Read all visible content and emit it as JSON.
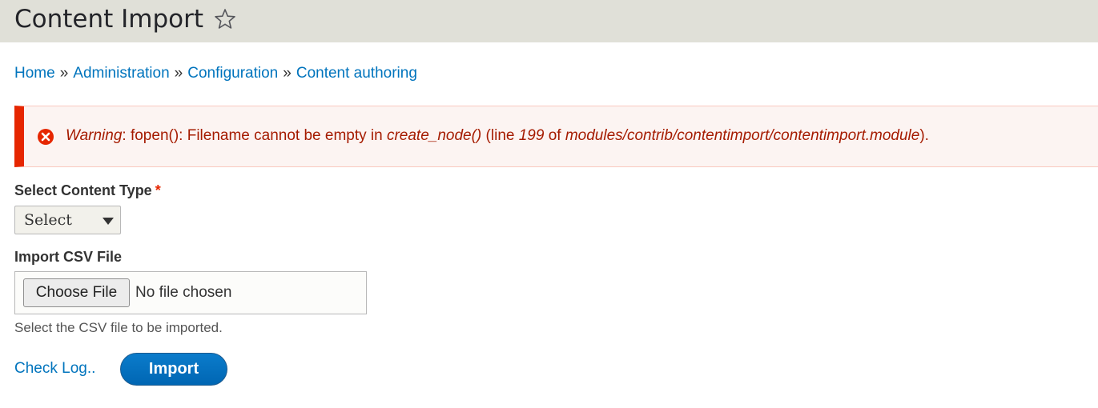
{
  "header": {
    "title": "Content Import"
  },
  "breadcrumb": [
    "Home",
    "Administration",
    "Configuration",
    "Content authoring"
  ],
  "breadcrumb_separator": "»",
  "alert": {
    "prefix": "Warning",
    "message": ": fopen(): Filename cannot be empty in ",
    "function": "create_node()",
    "line_label": " (line ",
    "line_number": "199",
    "of_label": " of ",
    "file": "modules/contrib/contentimport/contentimport.module",
    "suffix": ").",
    "color": "#e62600"
  },
  "form": {
    "content_type": {
      "label": "Select Content Type",
      "required_mark": "*",
      "selected": "Select"
    },
    "csv_file": {
      "label": "Import CSV File",
      "choose_button": "Choose File",
      "status": "No file chosen",
      "description": "Select the CSV file to be imported."
    },
    "check_log_link": "Check Log..",
    "import_button": "Import"
  },
  "colors": {
    "header_bg": "#e0e0d8",
    "link": "#0074bd",
    "primary_button": "#0071b8",
    "error": "#e62600"
  }
}
